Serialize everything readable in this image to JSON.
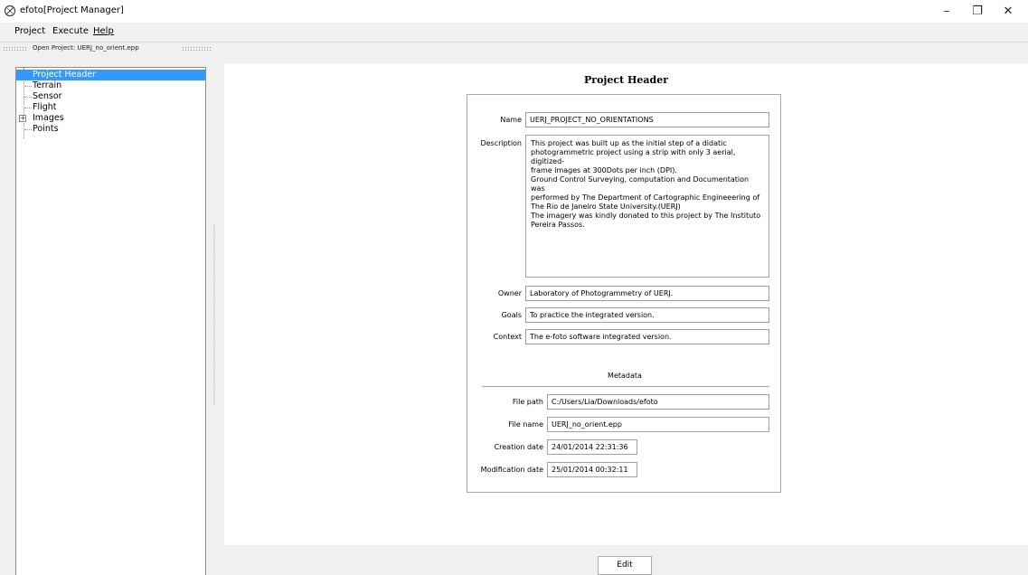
{
  "window": {
    "title": "efoto[Project Manager]",
    "icon": "efoto-logo-icon",
    "controls": {
      "minimize": "–",
      "maximize": "❐",
      "close": "✕"
    }
  },
  "menu": {
    "items": [
      {
        "label": "Project"
      },
      {
        "label": "Execute"
      },
      {
        "label": "Help"
      }
    ]
  },
  "toolbar": {
    "open_project": "Open Project: UERJ_no_orient.epp"
  },
  "tree": {
    "items": [
      {
        "label": "Project Header",
        "selected": true
      },
      {
        "label": "Terrain"
      },
      {
        "label": "Sensor"
      },
      {
        "label": "Flight"
      },
      {
        "label": "Images",
        "expander": "+"
      },
      {
        "label": "Points"
      }
    ]
  },
  "header": {
    "title": "Project Header",
    "name_label": "Name",
    "name_value": "UERJ_PROJECT_NO_ORIENTATIONS",
    "description_label": "Description",
    "description_value": "This project was built up as the initial step of a didatic\nphotogrammetric project using a strip with only 3 aerial, digitized-\nframe images at 300Dots per inch (DPI).\nGround Control Surveying, computation and Documentation was\nperformed by The Department of Cartographic Engineeering of\nThe Rio de Janeiro State University.(UERJ)\nThe imagery was kindly donated to this project by The Instituto\nPereira Passos.",
    "owner_label": "Owner",
    "owner_value": "Laboratory of Photogrammetry of UERJ.",
    "goals_label": "Goals",
    "goals_value": "To practice the integrated version.",
    "context_label": "Context",
    "context_value": "The e-foto software integrated version."
  },
  "metadata": {
    "title": "Metadata",
    "file_path_label": "File path",
    "file_path_value": "C:/Users/Lia/Downloads/efoto",
    "file_name_label": "File name",
    "file_name_value": "UERJ_no_orient.epp",
    "creation_label": "Creation date",
    "creation_value": "24/01/2014 22:31:36",
    "modification_label": "Modification date",
    "modification_value": "25/01/2014 00:32:11"
  },
  "actions": {
    "edit": "Edit"
  }
}
